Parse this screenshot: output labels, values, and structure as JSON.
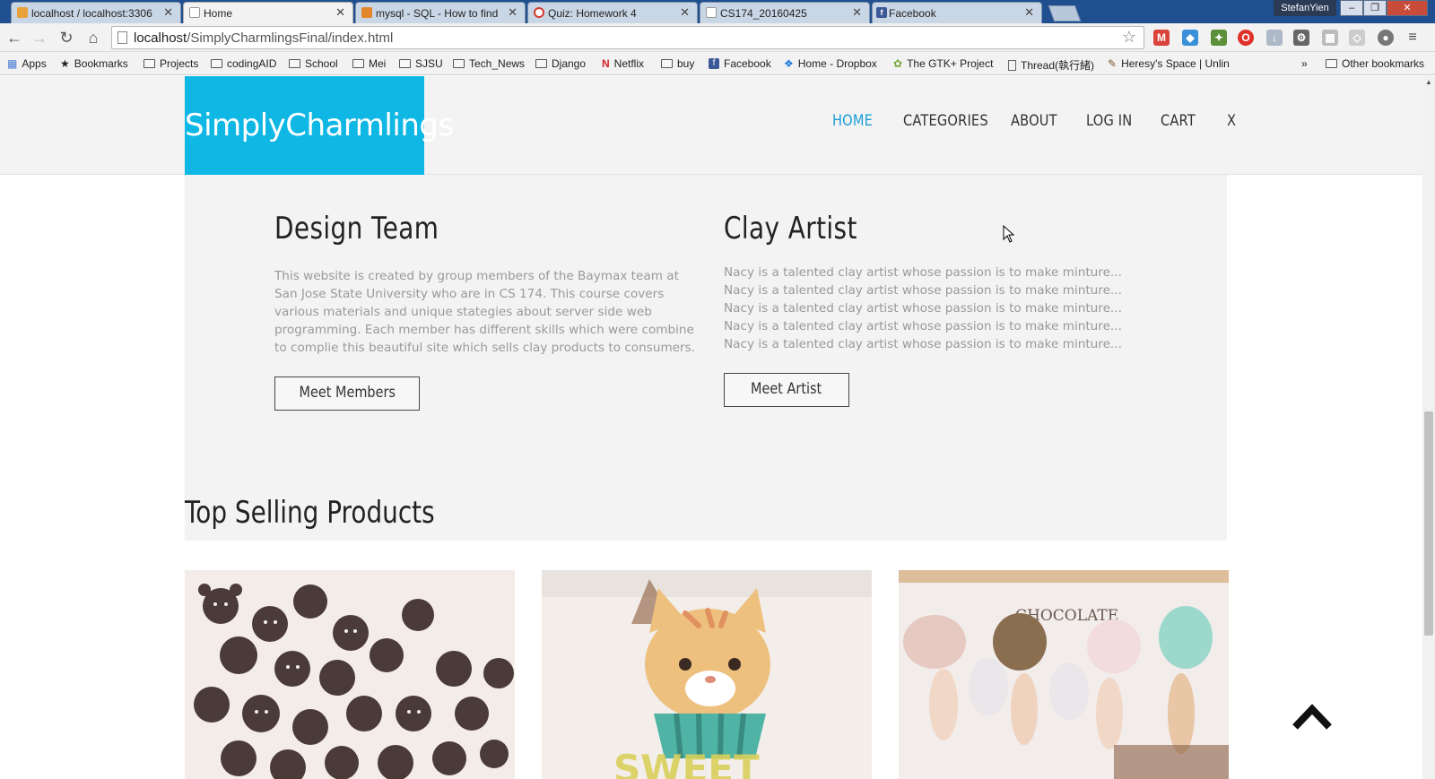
{
  "browser": {
    "tabs": [
      {
        "label": "localhost / localhost:3306",
        "favicon_color": "#e9a23b"
      },
      {
        "label": "Home",
        "favicon_color": "#ffffff"
      },
      {
        "label": "mysql - SQL - How to find",
        "favicon_color": "#e3872d"
      },
      {
        "label": "Quiz: Homework 4",
        "favicon_color": "#d33a2c"
      },
      {
        "label": "CS174_20160425",
        "favicon_color": "#ffffff"
      },
      {
        "label": "Facebook",
        "favicon_color": "#3b5998"
      }
    ],
    "user_label": "StefanYien",
    "url_host": "localhost",
    "url_path": "/SimplyCharmlingsFinal/index.html",
    "bookmarks": [
      {
        "label": "Apps",
        "icon": "apps-grid-icon"
      },
      {
        "label": "Bookmarks",
        "icon": "star-icon"
      },
      {
        "label": "Projects",
        "icon": "folder-icon"
      },
      {
        "label": "codingAID",
        "icon": "folder-icon"
      },
      {
        "label": "School",
        "icon": "folder-icon"
      },
      {
        "label": "Mei",
        "icon": "folder-icon"
      },
      {
        "label": "SJSU",
        "icon": "folder-icon"
      },
      {
        "label": "Tech_News",
        "icon": "folder-icon"
      },
      {
        "label": "Django",
        "icon": "folder-icon"
      },
      {
        "label": "Netflix",
        "icon": "netflix-icon"
      },
      {
        "label": "buy",
        "icon": "folder-icon"
      },
      {
        "label": "Facebook",
        "icon": "facebook-icon"
      },
      {
        "label": "Home - Dropbox",
        "icon": "dropbox-icon"
      },
      {
        "label": "The GTK+ Project",
        "icon": "gtk-icon"
      },
      {
        "label": "Thread(執行緒)",
        "icon": "page-icon"
      },
      {
        "label": "Heresy's Space | Unlin",
        "icon": "pen-icon"
      }
    ],
    "bookmarks_overflow": "»",
    "other_bookmarks": "Other bookmarks"
  },
  "site": {
    "logo": "SimplyCharmlings",
    "nav": [
      "HOME",
      "CATEGORIES",
      "ABOUT",
      "LOG IN",
      "CART",
      "X"
    ],
    "accent_color": "#0fb7e5",
    "design_team": {
      "title": "Design Team",
      "text": "This website is created by group members of the Baymax team at San Jose State University who are in CS 174. This course covers various materials and unique stategies about server side web programming. Each member has different skills which were combine to complie this beautiful site which sells clay products to consumers.",
      "button": "Meet Members"
    },
    "clay_artist": {
      "title": "Clay Artist",
      "text": "Nacy is a talented clay artist whose passion is to make minture... Nacy is a talented clay artist whose passion is to make minture... Nacy is a talented clay artist whose passion is to make minture... Nacy is a talented clay artist whose passion is to make minture... Nacy is a talented clay artist whose passion is to make minture...",
      "button": "Meet Artist"
    },
    "top_selling_title": "Top Selling Products",
    "products": [
      {
        "name": "chocolate-bears-photo"
      },
      {
        "name": "kitty-cupcake-photo",
        "sign": "SWEET"
      },
      {
        "name": "fairy-figurines-photo",
        "sign": "CHOCOLATE"
      }
    ]
  }
}
